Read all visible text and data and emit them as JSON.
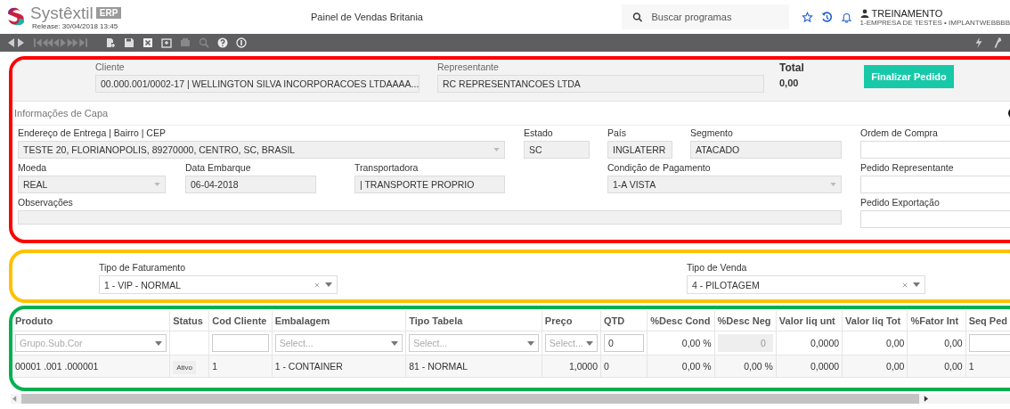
{
  "header": {
    "logo_text": "Systêxtil",
    "logo_badge": "ERP",
    "release": "Release: 30/04/2018 13:45",
    "title": "Painel de Vendas Britania",
    "search": {
      "placeholder": "Buscar programas"
    },
    "user": "TREINAMENTO",
    "company": "1-EMPRESA DE TESTES • IMPLANTWEBBBB"
  },
  "panels": [
    {
      "kind": "order",
      "color": "#ff0000",
      "top_fields": [
        {
          "label": "Cliente",
          "value": "00.000.001/0002-17 | WELLINGTON SILVA INCORPORACOES LTDAAAA..."
        },
        {
          "label": "Representante",
          "value": "RC REPRESENTANCOES LTDA"
        }
      ],
      "total": {
        "label": "Total",
        "value": "0,00"
      },
      "finish_button": "Finalizar Pedido",
      "section_title": "Informações de Capa",
      "fields": [
        {
          "label": "Endereço de Entrega | Bairro | CEP",
          "value": "TESTE 20, FLORIANOPOLIS, 89270000, CENTRO, SC, BRASIL",
          "kind": "select"
        },
        {
          "label": "Estado",
          "value": "SC",
          "kind": "text"
        },
        {
          "label": "País",
          "value": "INGLATERR",
          "kind": "text"
        },
        {
          "label": "Segmento",
          "value": "ATACADO",
          "kind": "text"
        },
        {
          "label": "Ordem de Compra",
          "kind": "input"
        },
        {
          "label": "Moeda",
          "value": "REAL",
          "kind": "select"
        },
        {
          "label": "Data Embarque",
          "value": "06-04-2018",
          "kind": "text"
        },
        {
          "label": "Transportadora",
          "value": "| TRANSPORTE PROPRIO",
          "kind": "text"
        },
        {
          "label": "Condição de Pagamento",
          "value": "1-A VISTA",
          "kind": "select"
        },
        {
          "label": "Pedido Representante",
          "kind": "input"
        },
        {
          "label": "Observações",
          "kind": "text"
        },
        {
          "label": "Pedido Exportação",
          "kind": "input"
        }
      ]
    },
    {
      "kind": "billing",
      "color": "#ffc000",
      "selects": [
        {
          "label": "Tipo de Faturamento",
          "value": "1 - VIP - NORMAL"
        },
        {
          "label": "Tipo de Venda",
          "value": "4 - PILOTAGEM"
        }
      ]
    },
    {
      "kind": "items",
      "color": "#00b050",
      "columns": [
        "Produto",
        "Status",
        "Cod Cliente",
        "Embalagem",
        "Tipo Tabela",
        "Preço",
        "QTD",
        "%Desc Cond",
        "%Desc Neg",
        "Valor liq unt",
        "Valor liq Tot",
        "%Fator Int",
        "Seq Ped"
      ],
      "filters": [
        {
          "kind": "select",
          "placeholder": "Grupo.Sub.Cor"
        },
        {
          "kind": "empty"
        },
        {
          "kind": "input"
        },
        {
          "kind": "select",
          "placeholder": "Select..."
        },
        {
          "kind": "select",
          "placeholder": "Select..."
        },
        {
          "kind": "select",
          "placeholder": "Select..."
        },
        {
          "kind": "input",
          "value": "0"
        },
        {
          "kind": "number",
          "value": "0,00 %"
        },
        {
          "kind": "readonly",
          "value": "0"
        },
        {
          "kind": "number",
          "value": "0,0000"
        },
        {
          "kind": "number",
          "value": "0,00"
        },
        {
          "kind": "number",
          "value": "0,00"
        },
        {
          "kind": "input"
        }
      ],
      "rows": [
        [
          {
            "text": "00001 .001 .000001"
          },
          {
            "text": "Ativo",
            "kind": "badge"
          },
          {
            "text": "1"
          },
          {
            "text": "1 - CONTAINER"
          },
          {
            "text": "81 - NORMAL"
          },
          {
            "text": "1,0000",
            "kind": "number"
          },
          {
            "text": "0"
          },
          {
            "text": "0,00 %",
            "kind": "number"
          },
          {
            "text": "0,00 %",
            "kind": "number"
          },
          {
            "text": "0,0000",
            "kind": "number"
          },
          {
            "text": "0,00",
            "kind": "number"
          },
          {
            "text": "0,00",
            "kind": "number"
          },
          {
            "text": "1"
          }
        ]
      ]
    }
  ]
}
